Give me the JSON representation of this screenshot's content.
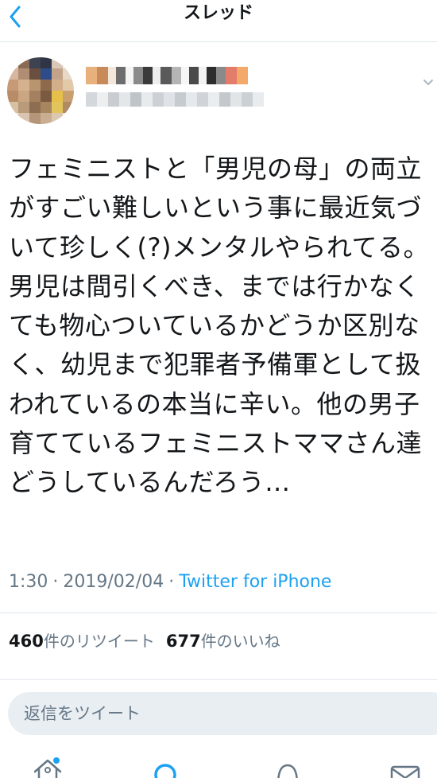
{
  "header": {
    "title": "スレッド"
  },
  "tweet": {
    "text": "フェミニストと「男児の母」の両立がすごい難しいという事に最近気づいて珍しく(?)メンタルやられてる。男児は間引くべき、までは行かなくても物心ついているかどうか区別なく、幼児まで犯罪者予備軍として扱われているの本当に辛い。他の男子育てているフェミニストママさん達どうしているんだろう…",
    "time": "1:30",
    "separator": "·",
    "date": "2019/02/04",
    "source": "Twitter for iPhone"
  },
  "stats": {
    "retweets_count": "460",
    "retweets_label": "件のリツイート",
    "likes_count": "677",
    "likes_label": "件のいいね"
  },
  "reply": {
    "placeholder": "返信をツイート"
  },
  "tabs": [
    {
      "icon": "home-icon"
    },
    {
      "icon": "search-icon"
    },
    {
      "icon": "notifications-icon"
    },
    {
      "icon": "messages-icon"
    }
  ],
  "colors": {
    "accent": "#1da1f2",
    "text": "#14171a",
    "secondary_text": "#657786",
    "divider": "#e1e8ed",
    "reply_background": "#e9eef2"
  }
}
